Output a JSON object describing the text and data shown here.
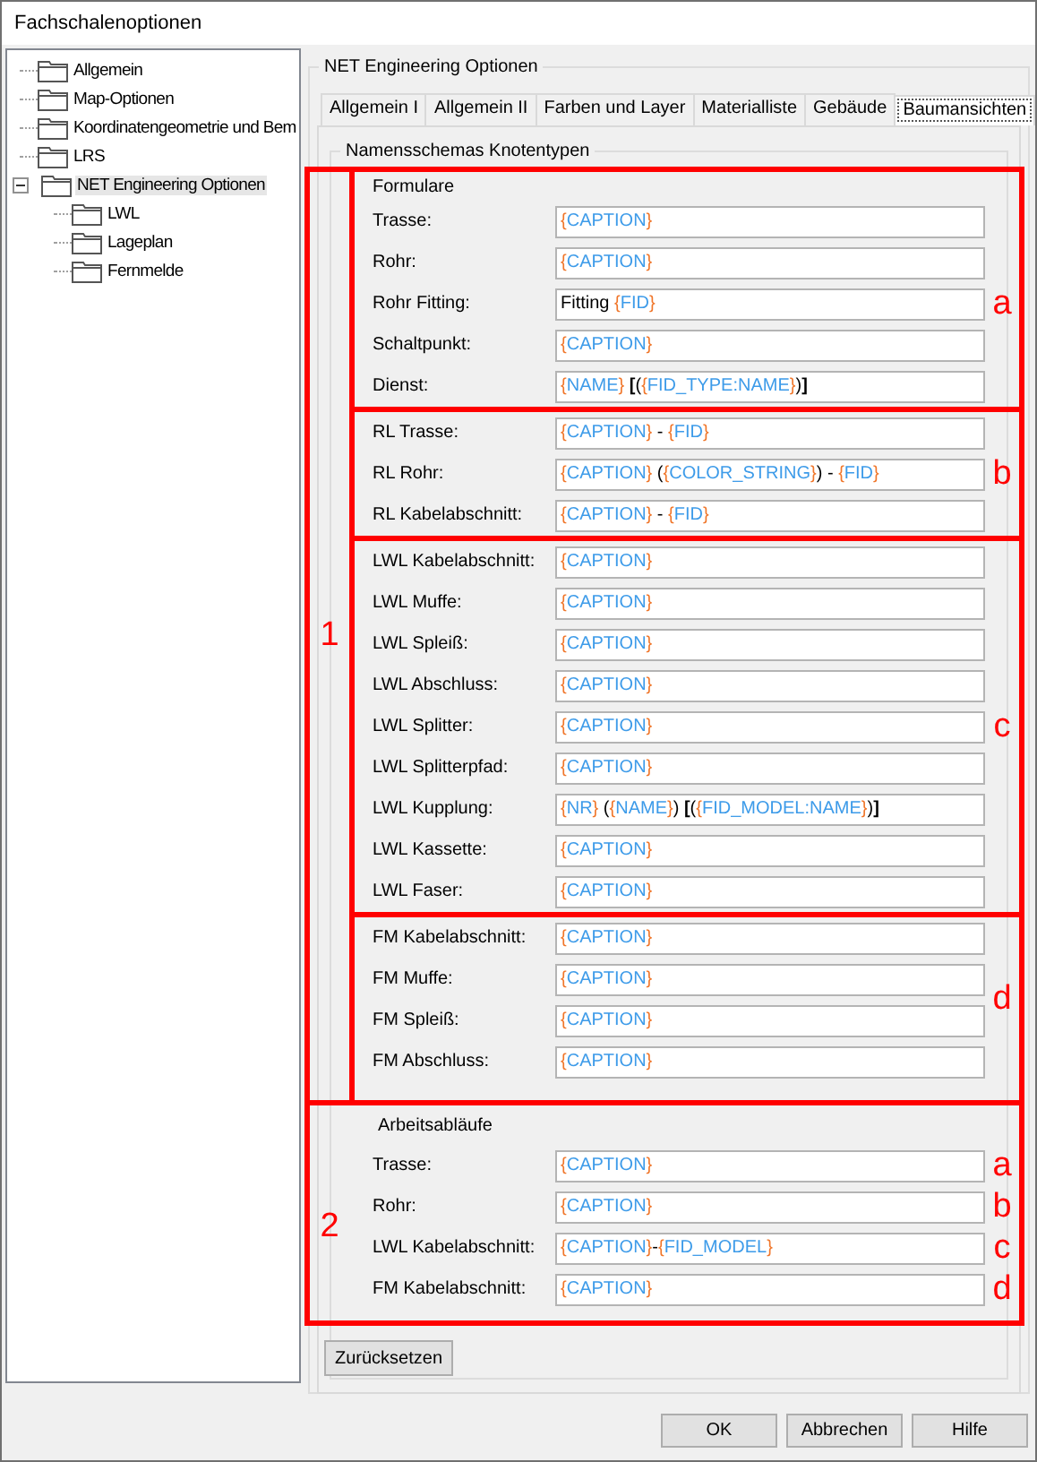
{
  "window": {
    "title": "Fachschalenoptionen"
  },
  "tree": [
    {
      "label": "Allgemein",
      "selected": false
    },
    {
      "label": "Map-Optionen",
      "selected": false
    },
    {
      "label": "Koordinatengeometrie und Bem",
      "selected": false
    },
    {
      "label": "LRS",
      "selected": false
    },
    {
      "label": "NET Engineering Optionen",
      "selected": true,
      "expanded": true,
      "children": [
        {
          "label": "LWL",
          "selected": false
        },
        {
          "label": "Lageplan",
          "selected": false
        },
        {
          "label": "Fernmelde",
          "selected": false
        }
      ]
    }
  ],
  "panel": {
    "title": "NET Engineering Optionen",
    "tabs": [
      {
        "label": "Allgemein I",
        "selected": false
      },
      {
        "label": "Allgemein II",
        "selected": false
      },
      {
        "label": "Farben und Layer",
        "selected": false
      },
      {
        "label": "Materialliste",
        "selected": false
      },
      {
        "label": "Gebäude",
        "selected": false
      },
      {
        "label": "Baumansichten",
        "selected": true
      }
    ],
    "group_title": "Namensschemas Knotentypen",
    "forms": {
      "title": "Formulare",
      "marker": "1",
      "subgroups": [
        {
          "marker": "a",
          "fields": [
            {
              "label": "Trasse:",
              "value": "{CAPTION}"
            },
            {
              "label": "Rohr:",
              "value": "{CAPTION}"
            },
            {
              "label": "Rohr Fitting:",
              "value": "Fitting {FID}"
            },
            {
              "label": "Schaltpunkt:",
              "value": "{CAPTION}"
            },
            {
              "label": "Dienst:",
              "value": "{NAME} [({FID_TYPE:NAME})]"
            }
          ]
        },
        {
          "marker": "b",
          "fields": [
            {
              "label": "RL Trasse:",
              "value": "{CAPTION} - {FID}"
            },
            {
              "label": "RL Rohr:",
              "value": "{CAPTION} ({COLOR_STRING}) - {FID}"
            },
            {
              "label": "RL Kabelabschnitt:",
              "value": "{CAPTION} - {FID}"
            }
          ]
        },
        {
          "marker": "c",
          "fields": [
            {
              "label": "LWL Kabelabschnitt:",
              "value": "{CAPTION}"
            },
            {
              "label": "LWL Muffe:",
              "value": "{CAPTION}"
            },
            {
              "label": "LWL Spleiß:",
              "value": "{CAPTION}"
            },
            {
              "label": "LWL Abschluss:",
              "value": "{CAPTION}"
            },
            {
              "label": "LWL Splitter:",
              "value": "{CAPTION}"
            },
            {
              "label": "LWL Splitterpfad:",
              "value": "{CAPTION}"
            },
            {
              "label": "LWL Kupplung:",
              "value": "{NR} ({NAME}) [({FID_MODEL:NAME})]"
            },
            {
              "label": "LWL Kassette:",
              "value": "{CAPTION}"
            },
            {
              "label": "LWL Faser:",
              "value": "{CAPTION}"
            }
          ]
        },
        {
          "marker": "d",
          "fields": [
            {
              "label": "FM Kabelabschnitt:",
              "value": "{CAPTION}"
            },
            {
              "label": "FM Muffe:",
              "value": "{CAPTION}"
            },
            {
              "label": "FM Spleiß:",
              "value": "{CAPTION}"
            },
            {
              "label": "FM Abschluss:",
              "value": "{CAPTION}"
            }
          ]
        }
      ]
    },
    "workflows": {
      "title": "Arbeitsabläufe",
      "marker": "2",
      "fields": [
        {
          "label": "Trasse:",
          "value": "{CAPTION}",
          "marker": "a"
        },
        {
          "label": "Rohr:",
          "value": "{CAPTION}",
          "marker": "b"
        },
        {
          "label": "LWL Kabelabschnitt:",
          "value": "{CAPTION}-{FID_MODEL}",
          "marker": "c"
        },
        {
          "label": "FM Kabelabschnitt:",
          "value": "{CAPTION}",
          "marker": "d"
        }
      ]
    },
    "reset_button": "Zurücksetzen"
  },
  "buttons": [
    "OK",
    "Abbrechen",
    "Hilfe"
  ]
}
